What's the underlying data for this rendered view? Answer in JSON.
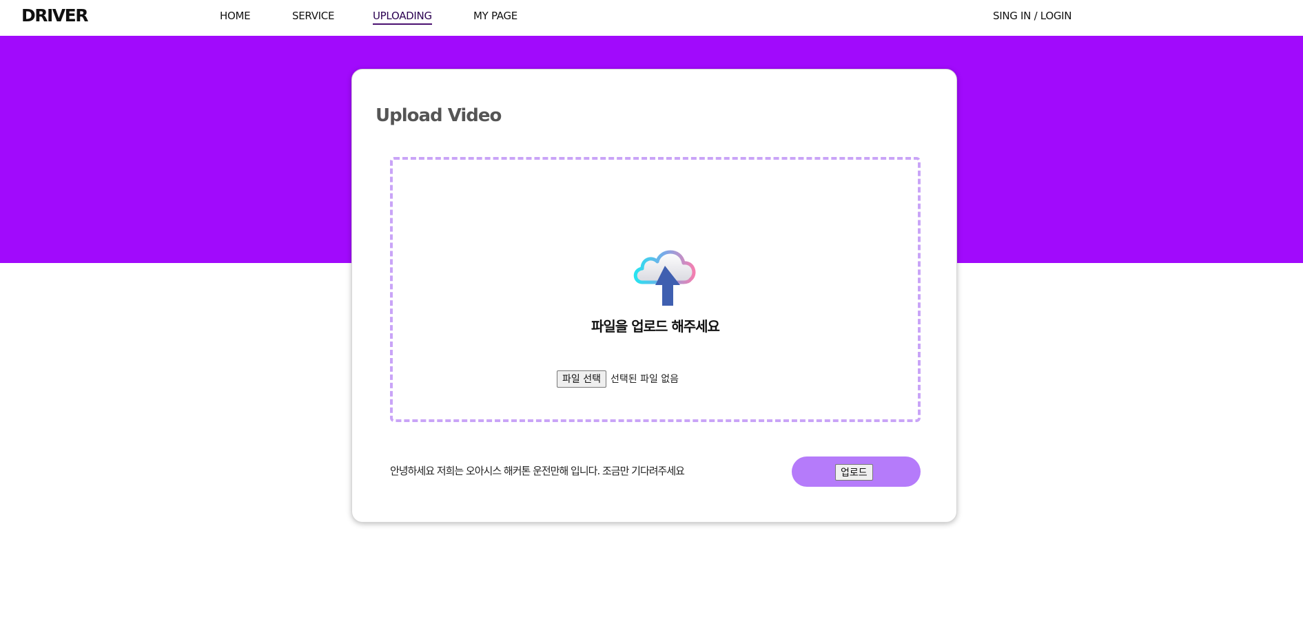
{
  "header": {
    "brand": "DRIVER",
    "nav": {
      "home": "HOME",
      "service": "SERVICE",
      "uploading": "UPLOADING",
      "mypage": "MY PAGE"
    },
    "login": "SING IN / LOGIN"
  },
  "colors": {
    "hero": "#a10afc",
    "dropzone_border": "#c9a4f7",
    "upload_pill": "#b57bfa"
  },
  "upload": {
    "title": "Upload Video",
    "drop_text": "파일을 업로드 해주세요",
    "file_button": "파일 선택",
    "file_status": "선택된 파일 없음",
    "note": "안녕하세요 저희는 오아시스 해커톤 운전만해 입니다. 조금만 기다려주세요",
    "submit_label": "업로드",
    "icon": "cloud-upload-icon"
  }
}
